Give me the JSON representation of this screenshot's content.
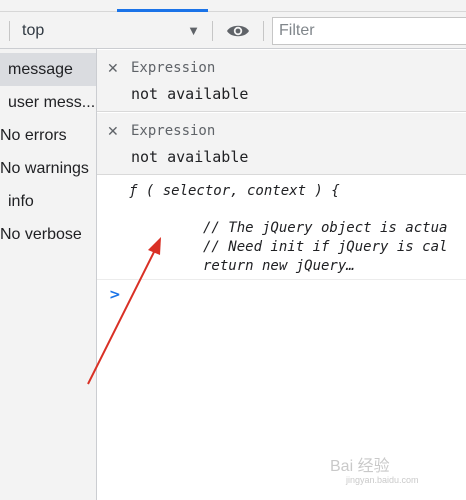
{
  "toolbar": {
    "context_value": "top",
    "context_arrow_icon": "triangle-down-icon",
    "live_expression_icon": "eye-icon",
    "filter_placeholder": "Filter"
  },
  "sidebar": {
    "items": [
      {
        "label": "message",
        "selected": true
      },
      {
        "label": "user mess..."
      },
      {
        "label": "No errors"
      },
      {
        "label": "No warnings"
      },
      {
        "label": "info"
      },
      {
        "label": "No verbose"
      }
    ]
  },
  "expressions": [
    {
      "close": "✕",
      "name": "Expression",
      "value": "not available"
    },
    {
      "close": "✕",
      "name": "Expression",
      "value": "not available"
    }
  ],
  "log": {
    "line1": "ƒ ( selector, context ) {",
    "line2": "// The jQuery object is actua",
    "line3": "// Need init if jQuery is cal",
    "line4": "return new jQuery…"
  },
  "console_prompt": ">",
  "watermark": {
    "text": "Bai 经验",
    "sub": "jingyan.baidu.com"
  },
  "colors": {
    "accent": "#1a73e8",
    "annotation_arrow": "#d93025"
  }
}
